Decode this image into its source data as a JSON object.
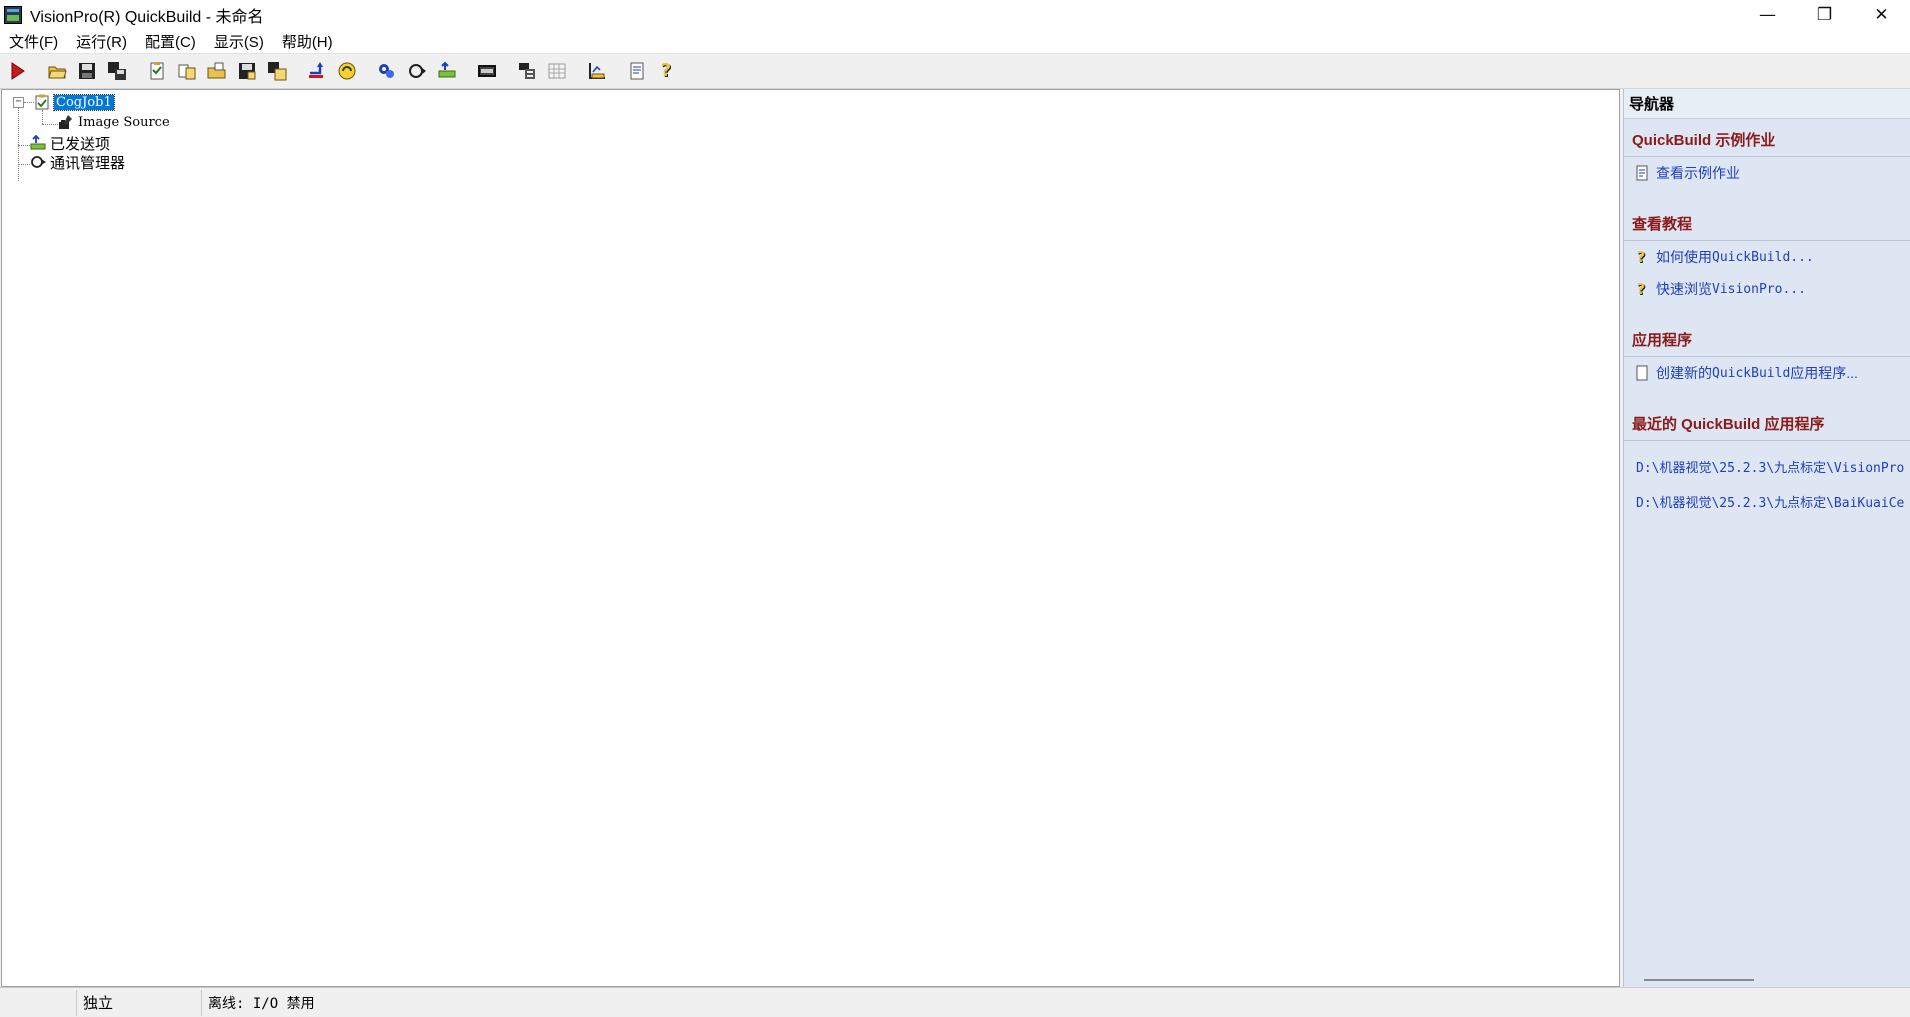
{
  "window": {
    "title": "VisionPro(R) QuickBuild - 未命名",
    "minimize_glyph": "—",
    "maximize_glyph": "❐",
    "close_glyph": "✕"
  },
  "menu": {
    "items": [
      "文件(F)",
      "运行(R)",
      "配置(C)",
      "显示(S)",
      "帮助(H)"
    ]
  },
  "toolbar": {
    "buttons": [
      "run-once-icon",
      "open-folder-icon",
      "save-icon",
      "save-as-icon",
      "job-properties-icon",
      "new-job-icon",
      "open-job-icon",
      "save-job-icon",
      "save-job-as-icon",
      "post-item-icon",
      "realtime-icon",
      "comm-manager-icon",
      "continuous-run-icon",
      "posted-items-icon",
      "image-display-icon",
      "job-list-icon",
      "grid-icon",
      "results-icon",
      "doc-icon",
      "help-icon"
    ]
  },
  "tree": {
    "job": "CogJob1",
    "image_source": "Image Source",
    "posted_items": "已发送项",
    "comm_manager": "通讯管理器",
    "expander_glyph": "−"
  },
  "navigator": {
    "title": "导航器",
    "samples_title": "QuickBuild 示例作业",
    "samples_link": "查看示例作业",
    "tutorials_title": "查看教程",
    "tutorial_1_prefix": "如何使用 ",
    "tutorial_1_mono": "QuickBuild...",
    "tutorial_2_prefix": "快速浏览 ",
    "tutorial_2_mono": "VisionPro...",
    "apps_title": "应用程序",
    "new_app_prefix": "创建新的 ",
    "new_app_mono": "QuickBuild",
    "new_app_suffix": " 应用程序...",
    "recent_title": "最近的 QuickBuild 应用程序",
    "recent_1": "D:\\机器视觉\\25.2.3\\九点标定\\VisionPro",
    "recent_2": "D:\\机器视觉\\25.2.3\\九点标定\\BaiKuaiCe"
  },
  "status": {
    "mode": "独立",
    "connection": "离线: I/O 禁用"
  },
  "colors": {
    "selection": "#0078d7",
    "link": "#1e3fbf",
    "section_title": "#8b1a1a",
    "navigator_bg": "#dde6f2"
  }
}
